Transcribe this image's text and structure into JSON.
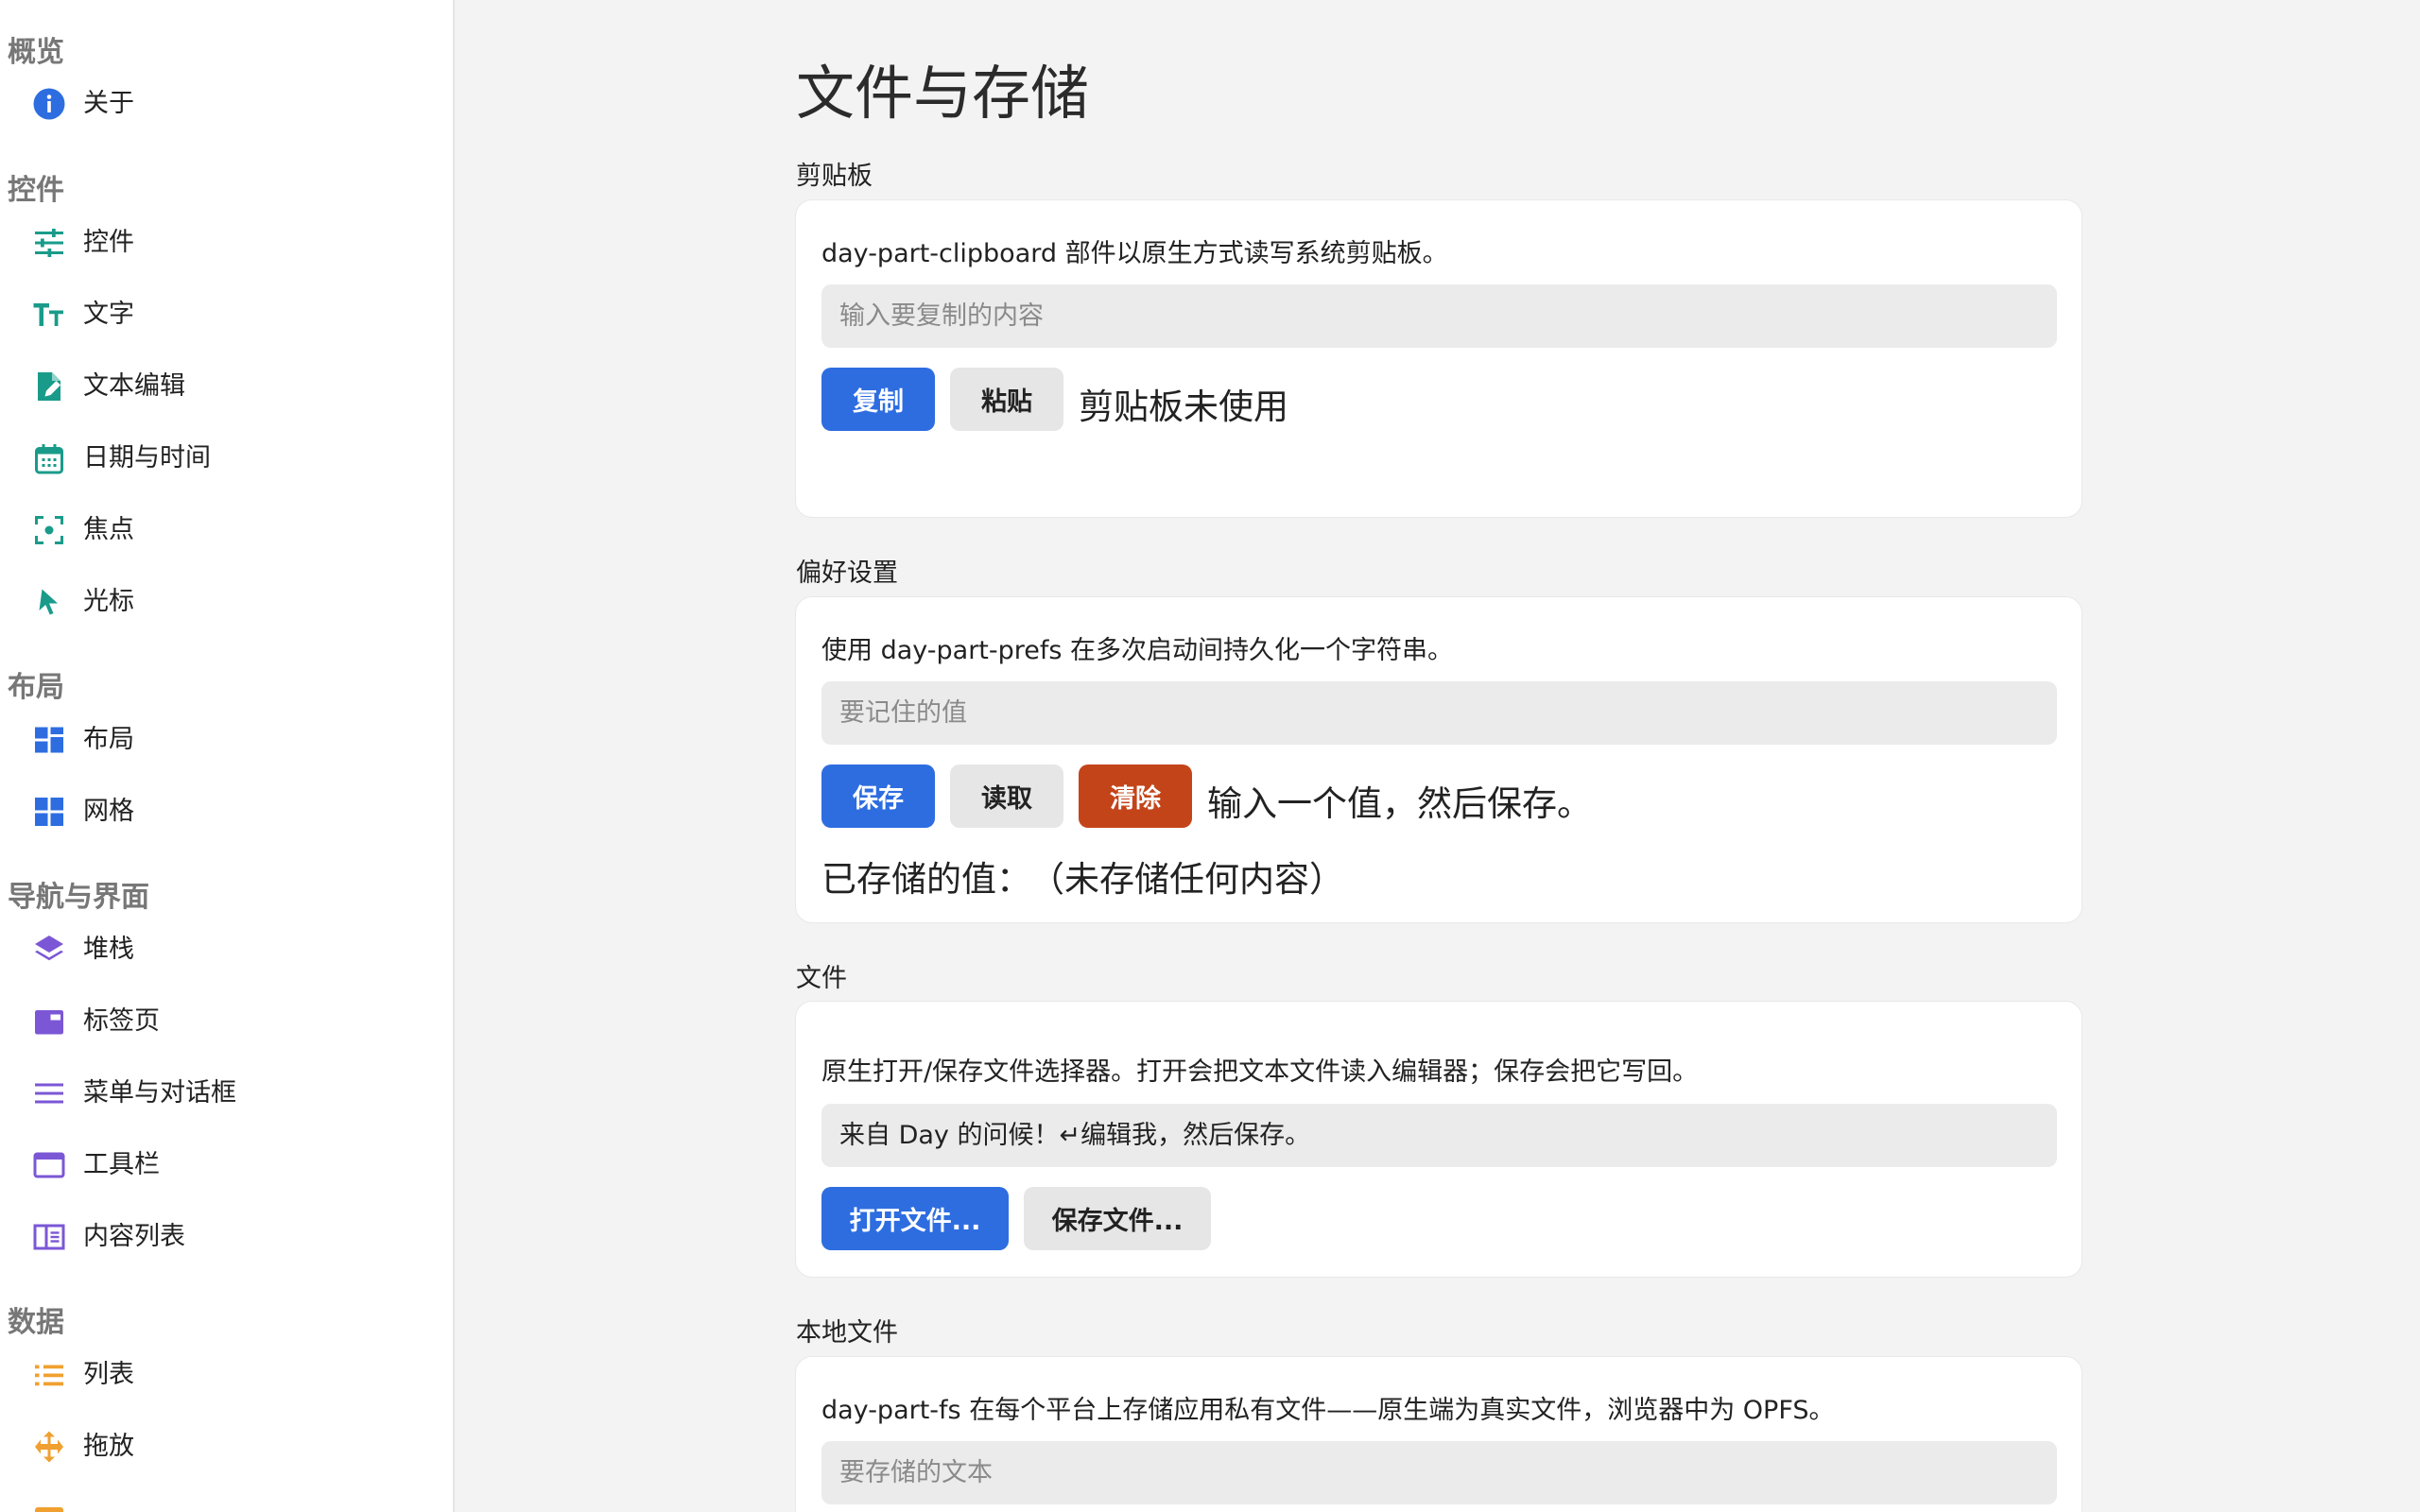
{
  "sidebar": {
    "groups": [
      {
        "label": "概览",
        "items": [
          {
            "label": "关于",
            "icon": "info-icon"
          }
        ]
      },
      {
        "label": "控件",
        "items": [
          {
            "label": "控件",
            "icon": "sliders-icon"
          },
          {
            "label": "文字",
            "icon": "text-size-icon"
          },
          {
            "label": "文本编辑",
            "icon": "file-edit-icon"
          },
          {
            "label": "日期与时间",
            "icon": "calendar-icon"
          },
          {
            "label": "焦点",
            "icon": "focus-icon"
          },
          {
            "label": "光标",
            "icon": "cursor-icon"
          }
        ]
      },
      {
        "label": "布局",
        "items": [
          {
            "label": "布局",
            "icon": "layout-icon"
          },
          {
            "label": "网格",
            "icon": "grid-icon"
          }
        ]
      },
      {
        "label": "导航与界面",
        "items": [
          {
            "label": "堆栈",
            "icon": "stack-icon"
          },
          {
            "label": "标签页",
            "icon": "tabs-icon"
          },
          {
            "label": "菜单与对话框",
            "icon": "menu-icon"
          },
          {
            "label": "工具栏",
            "icon": "toolbar-icon"
          },
          {
            "label": "内容列表",
            "icon": "content-list-icon"
          }
        ]
      },
      {
        "label": "数据",
        "items": [
          {
            "label": "列表",
            "icon": "list-icon"
          },
          {
            "label": "拖放",
            "icon": "drag-icon"
          },
          {
            "label": "",
            "icon": "box-icon"
          }
        ]
      }
    ]
  },
  "main": {
    "title": "文件与存储",
    "clipboard": {
      "section_label": "剪贴板",
      "description": "day-part-clipboard 部件以原生方式读写系统剪贴板。",
      "input_placeholder": "输入要复制的内容",
      "copy_label": "复制",
      "paste_label": "粘贴",
      "status": "剪贴板未使用"
    },
    "prefs": {
      "section_label": "偏好设置",
      "description": "使用 day-part-prefs 在多次启动间持久化一个字符串。",
      "input_placeholder": "要记住的值",
      "save_label": "保存",
      "load_label": "读取",
      "clear_label": "清除",
      "status": "输入一个值，然后保存。",
      "stored_label": "已存储的值：",
      "stored_value": "（未存储任何内容）"
    },
    "files": {
      "section_label": "文件",
      "description": "原生打开/保存文件选择器。打开会把文本文件读入编辑器；保存会把它写回。",
      "editor_value": "来自 Day 的问候！↵编辑我，然后保存。",
      "open_label": "打开文件...",
      "save_label": "保存文件..."
    },
    "local_files": {
      "section_label": "本地文件",
      "description": "day-part-fs 在每个平台上存储应用私有文件——原生端为真实文件，浏览器中为 OPFS。",
      "input_placeholder": "要存储的文本"
    }
  },
  "colors": {
    "primary": "#2d6de0",
    "danger": "#c4441a",
    "teal_icon": "#1a9b8a",
    "blue_icon": "#2d6de0",
    "purple_icon": "#7b57d6",
    "orange_icon": "#f0a030"
  }
}
